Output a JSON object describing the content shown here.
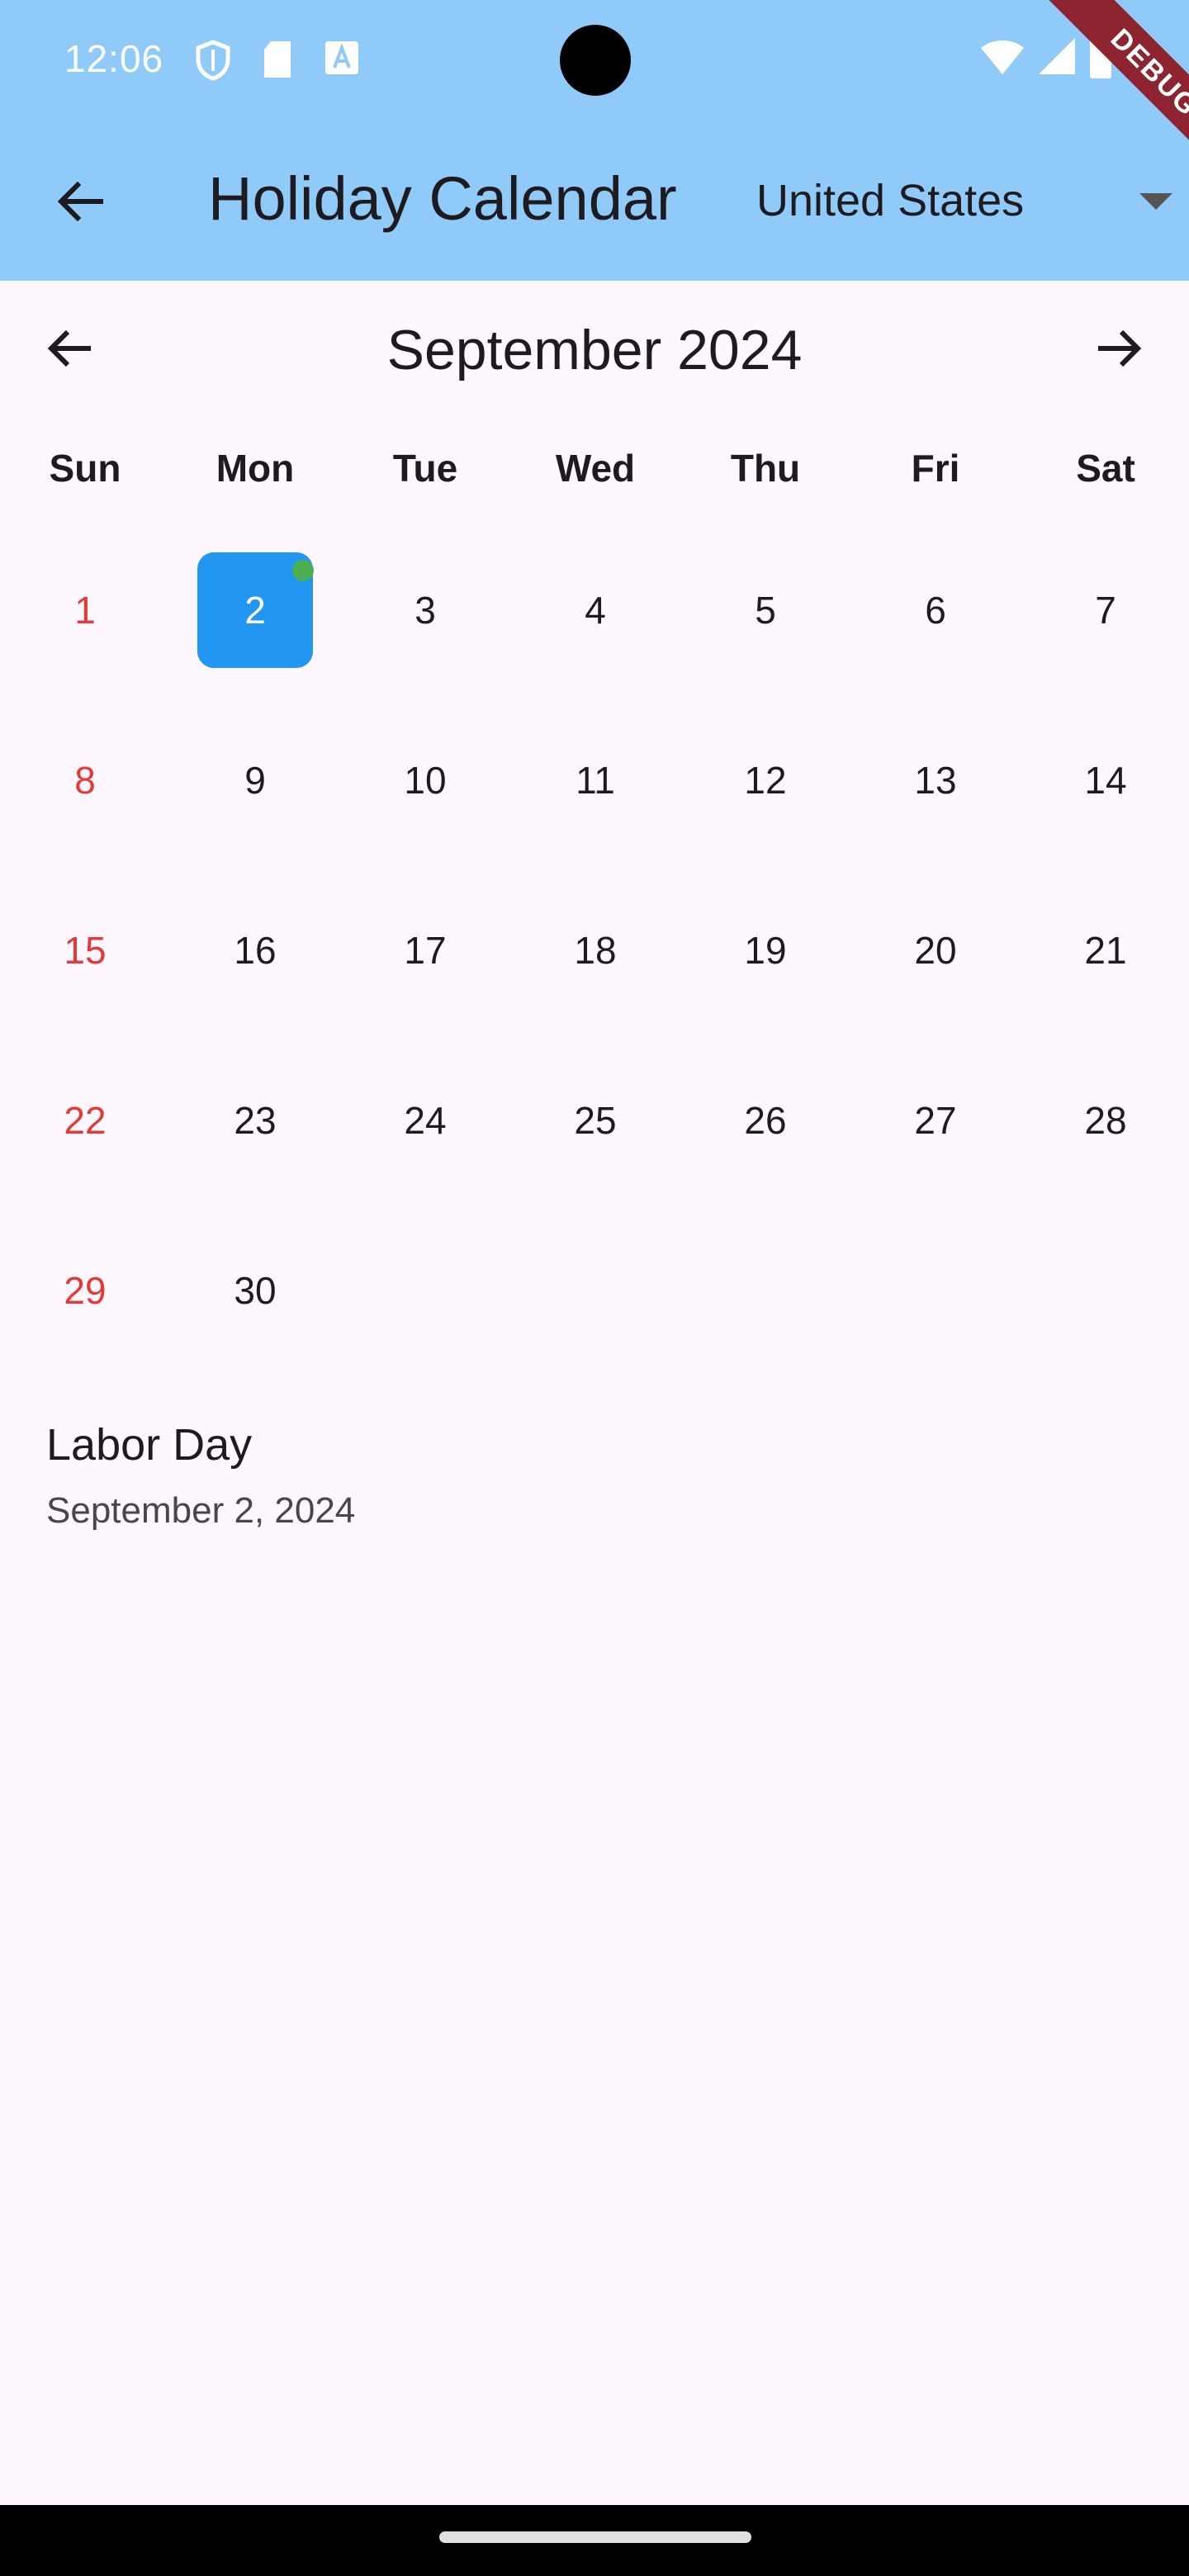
{
  "status_bar": {
    "time": "12:06",
    "left_icons": [
      "shield-icon",
      "sd-card-icon",
      "text-a-icon"
    ],
    "right_icons": [
      "wifi-icon",
      "cell-signal-icon",
      "battery-icon"
    ],
    "debug_label": "DEBUG"
  },
  "app_bar": {
    "title": "Holiday Calendar",
    "country": "United States",
    "background": "#90caf9"
  },
  "calendar": {
    "month_label": "September 2024",
    "weekdays": [
      "Sun",
      "Mon",
      "Tue",
      "Wed",
      "Thu",
      "Fri",
      "Sat"
    ],
    "first_weekday_index": 0,
    "days_in_month": 30,
    "selected_day": 2,
    "holiday_days": [
      2
    ],
    "days": [
      "1",
      "2",
      "3",
      "4",
      "5",
      "6",
      "7",
      "8",
      "9",
      "10",
      "11",
      "12",
      "13",
      "14",
      "15",
      "16",
      "17",
      "18",
      "19",
      "20",
      "21",
      "22",
      "23",
      "24",
      "25",
      "26",
      "27",
      "28",
      "29",
      "30"
    ],
    "colors": {
      "sunday": "#e53935",
      "selected": "#2196f3",
      "holiday_marker": "#4caf50"
    }
  },
  "holidays": [
    {
      "name": "Labor Day",
      "date": "September 2, 2024"
    }
  ]
}
